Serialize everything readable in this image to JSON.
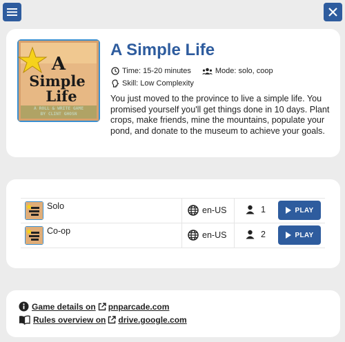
{
  "nav": {
    "menu_icon": "hamburger-menu-icon",
    "close_icon": "close-x-icon"
  },
  "game": {
    "title": "A Simple Life",
    "cover_text": {
      "line1": "A",
      "line2": "Simple",
      "line3": "Life",
      "subtitle1": "A ROLL & WRITE GAME",
      "subtitle2": "BY CLINT GHOSN"
    },
    "time": "Time: 15-20 minutes",
    "mode": "Mode: solo, coop",
    "skill": "Skill: Low Complexity",
    "description": "You just moved to the province to live a simple life. You promised yourself you'll get things done in 10 days. Plant crops, make friends, mine the mountains, populate your pond, and donate to the museum to achieve your goals."
  },
  "modes": [
    {
      "name": "Solo",
      "language": "en-US",
      "players": "1",
      "play_label": "PLAY"
    },
    {
      "name": "Co-op",
      "language": "en-US",
      "players": "2",
      "play_label": "PLAY"
    }
  ],
  "links": {
    "details_prefix": "Game details on",
    "details_site": "pnparcade.com",
    "rules_prefix": "Rules overview on",
    "rules_site": "drive.google.com"
  },
  "colors": {
    "accent": "#2e5c9e",
    "background": "#ececec",
    "card": "#ffffff"
  }
}
